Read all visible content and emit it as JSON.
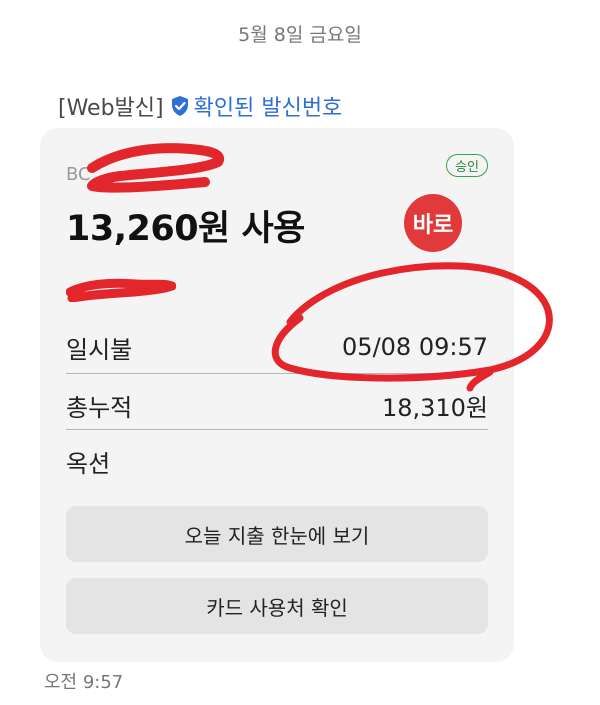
{
  "date_header": "5월 8일 금요일",
  "sender": {
    "tag": "[Web발신]",
    "verified_label": "확인된 발신번호"
  },
  "card": {
    "issuer_prefix": "BC",
    "approved_badge": "승인",
    "amount": "13,260원 사용",
    "logo_text": "바로",
    "rows": [
      {
        "label": "일시불",
        "value": "05/08 09:57"
      },
      {
        "label": "총누적",
        "value": "18,310원"
      },
      {
        "label": "옥션",
        "value": ""
      }
    ],
    "buttons": {
      "today_spending": "오늘 지출 한눈에 보기",
      "card_usage": "카드 사용처 확인"
    }
  },
  "timestamp": "오전 9:57",
  "colors": {
    "verified_blue": "#2f6fd6",
    "approved_green": "#2e8b3d",
    "logo_red": "#e23a3a",
    "annotation_red": "#e3262b",
    "card_bg": "#f4f4f4"
  },
  "icons": {
    "verified": "shield-check-icon"
  }
}
